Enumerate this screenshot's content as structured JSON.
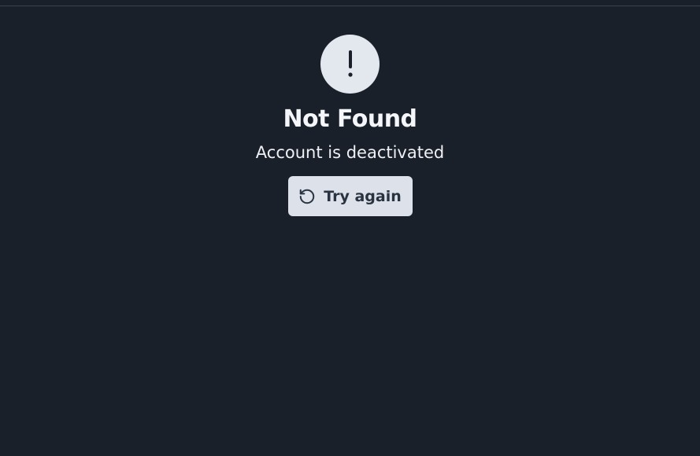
{
  "error": {
    "icon": "exclamation-icon",
    "title": "Not Found",
    "message": "Account is deactivated",
    "retry_label": "Try again",
    "retry_icon": "refresh-icon"
  },
  "colors": {
    "background": "#1a202a",
    "icon_circle": "#e3e7ee",
    "button_background": "#dde2ea",
    "button_text": "#2a3342",
    "title_text": "#f4f6f9"
  }
}
